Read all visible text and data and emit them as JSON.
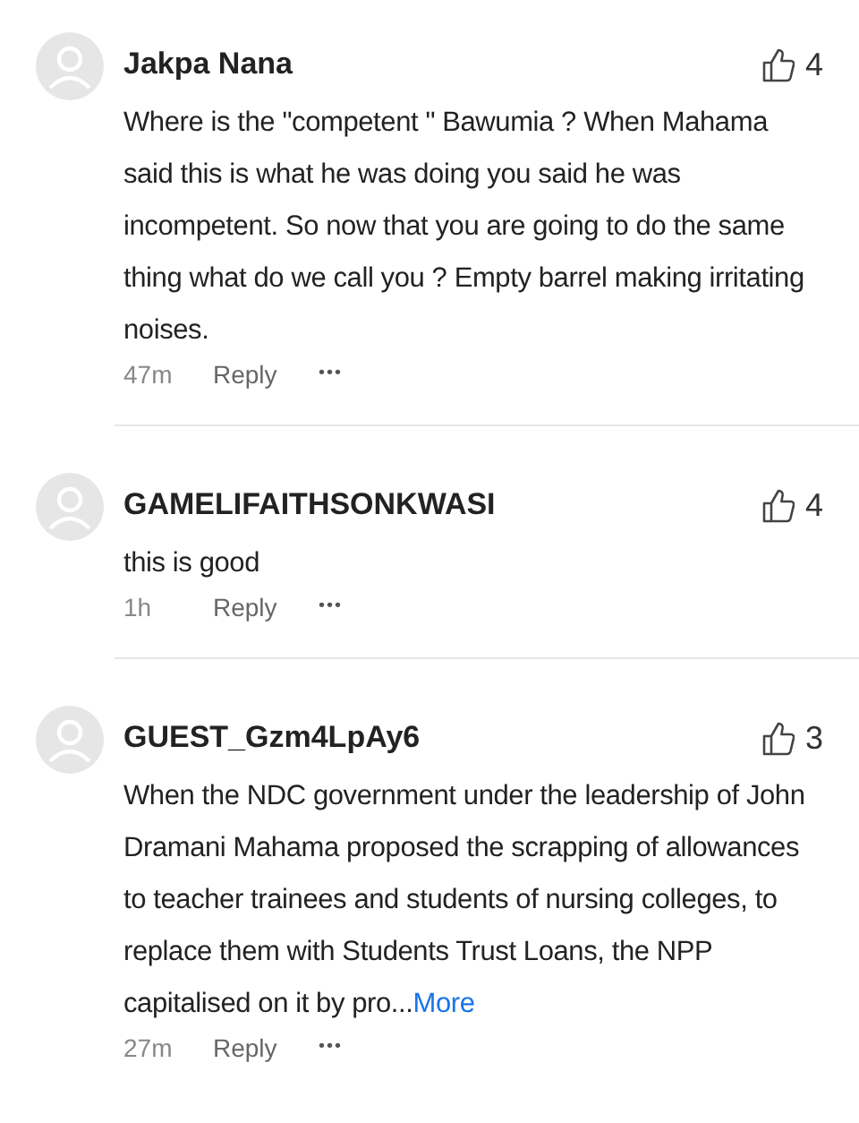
{
  "comments": [
    {
      "author": "Jakpa Nana",
      "likes": "4",
      "body": "Where is the \"competent \" Bawumia ? When Mahama said this is what he was doing you said he was incompetent.  So now that you are going to do the same thing what do we call you ? Empty barrel making irritating noises.",
      "time": "47m",
      "reply": "Reply",
      "more_actions": "•••"
    },
    {
      "author": "GAMELIFAITHSONKWASI",
      "likes": "4",
      "body": "this is good",
      "time": "1h",
      "reply": "Reply",
      "more_actions": "•••"
    },
    {
      "author": "GUEST_Gzm4LpAy6",
      "likes": "3",
      "body": "When the NDC government under the leadership of John Dramani Mahama proposed the scrapping of allowances to teacher trainees and students of nursing colleges, to replace  them with  Students Trust Loans, the NPP capitalised on it  by pro...",
      "more_link": "More",
      "time": "27m",
      "reply": "Reply",
      "more_actions": "•••"
    }
  ]
}
